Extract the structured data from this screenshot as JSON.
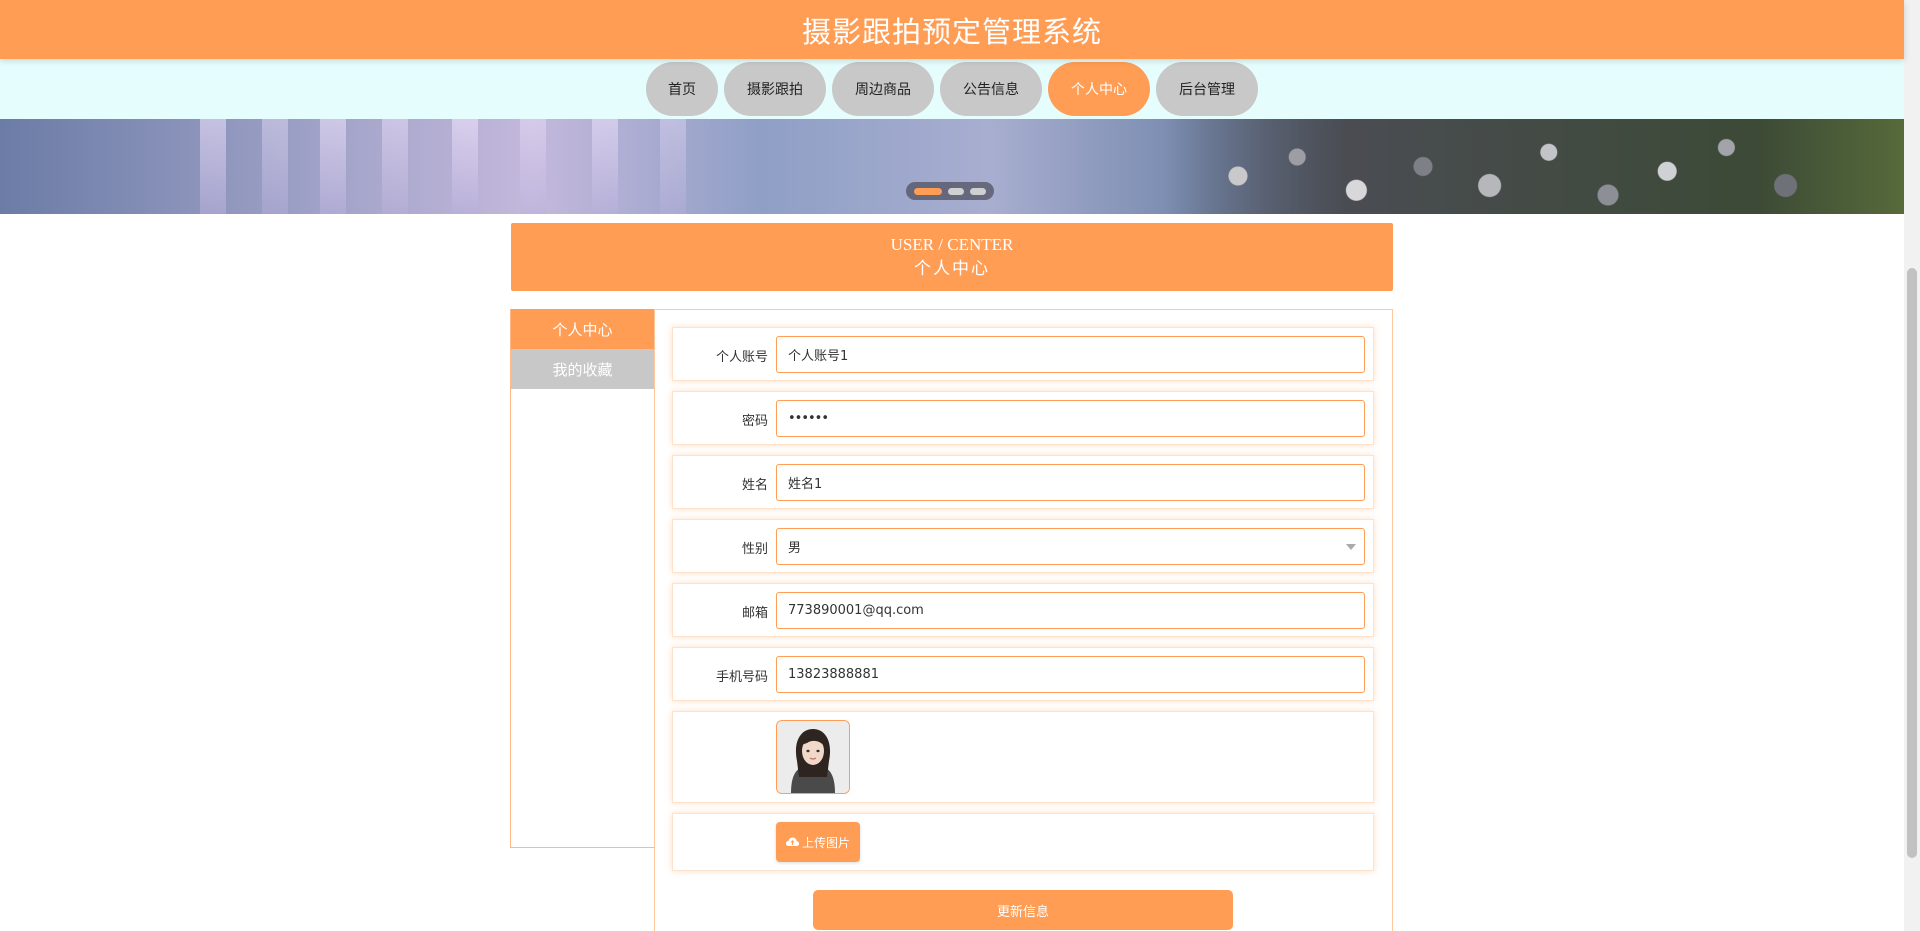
{
  "header": {
    "title": "摄影跟拍预定管理系统"
  },
  "nav": {
    "items": [
      "首页",
      "摄影跟拍",
      "周边商品",
      "公告信息",
      "个人中心",
      "后台管理"
    ],
    "active": "个人中心"
  },
  "banner": {
    "slide_count": 3,
    "active_slide": 1
  },
  "section": {
    "title_en": "USER / CENTER",
    "title_cn": "个人中心"
  },
  "sidebar": {
    "items": [
      "个人中心",
      "我的收藏"
    ],
    "active": "个人中心"
  },
  "form": {
    "account": {
      "label": "个人账号",
      "value": "个人账号1"
    },
    "password": {
      "label": "密码",
      "value": "••••••"
    },
    "name": {
      "label": "姓名",
      "value": "姓名1"
    },
    "gender": {
      "label": "性别",
      "value": "男"
    },
    "email": {
      "label": "邮箱",
      "value": "773890001@qq.com"
    },
    "phone": {
      "label": "手机号码",
      "value": "13823888881"
    },
    "upload_label": "上传图片",
    "submit_label": "更新信息"
  },
  "colors": {
    "accent": "#ff9d55",
    "nav_bg": "#e6fdfe",
    "inactive": "#c8c8c8"
  }
}
